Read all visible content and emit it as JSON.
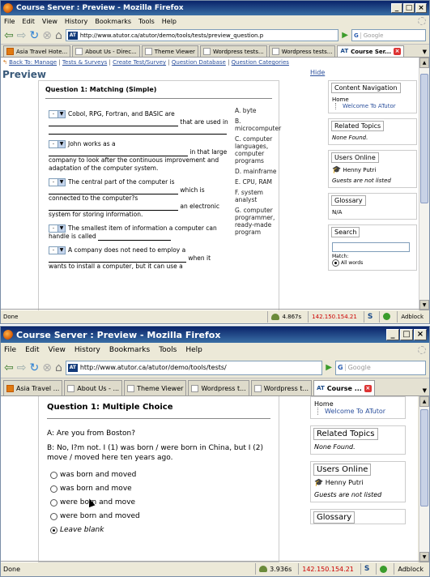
{
  "window1": {
    "title": "Course Server : Preview - Mozilla Firefox",
    "menu": [
      "File",
      "Edit",
      "View",
      "History",
      "Bookmarks",
      "Tools",
      "Help"
    ],
    "url": "http://www.atutor.ca/atutor/demo/tools/tests/preview_question.p",
    "search_placeholder": "Google",
    "tabs": [
      "Asia Travel Hote...",
      "About Us - Direc...",
      "Theme Viewer",
      "Wordpress tests...",
      "Wordpress tests...",
      "Course Ser..."
    ],
    "breadcrumbs": {
      "back": "Back To: Manage",
      "items": [
        "Tests & Surveys",
        "Create Test/Survey",
        "Question Database",
        "Question Categories"
      ]
    },
    "page_title": "Preview",
    "hide_label": "Hide",
    "question_heading": "Question 1:   Matching (Simple)",
    "dropdown_value": "-",
    "rows": [
      {
        "pre": "Cobol, RPG, Fortran, and BASIC are",
        "mid": "that are used in"
      },
      {
        "pre": "John works as a",
        "mid": "in that large",
        "post": "company to look after the continuous improvement and adaptation of the computer system."
      },
      {
        "pre": "The central part of the computer is",
        "mid": "which is",
        "post": "connected to the computer?s",
        "post2": "an electronic system for storing information."
      },
      {
        "pre": "The smallest item of information a computer can handle is called"
      },
      {
        "pre": "A company does not need to employ a",
        "mid": "when it",
        "post": "wants to install a computer, but it can use a"
      }
    ],
    "answers": [
      "A. byte",
      "B. microcomputer",
      "C. computer languages, computer programs",
      "D. mainframe",
      "E. CPU, RAM",
      "F. system analyst",
      "G. computer programmer, ready-made program"
    ],
    "sidebar": {
      "content_nav": "Content Navigation",
      "home": "Home",
      "welcome": "Welcome To ATutor",
      "related": "Related Topics",
      "none_found": "None Found.",
      "users_online": "Users Online",
      "user": "Henny Putri",
      "guests": "Guests are not listed",
      "glossary": "Glossary",
      "na": "N/A",
      "search": "Search",
      "match": "Match:",
      "all_words": "All words"
    },
    "status": {
      "done": "Done",
      "time": "4.867s",
      "ip": "142.150.154.21",
      "adblock": "Adblock"
    }
  },
  "window2": {
    "title": "Course Server : Preview - Mozilla Firefox",
    "menu": [
      "File",
      "Edit",
      "View",
      "History",
      "Bookmarks",
      "Tools",
      "Help"
    ],
    "url": "http://www.atutor.ca/atutor/demo/tools/tests/",
    "search_placeholder": "Google",
    "tabs": [
      "Asia Travel ...",
      "About Us - ...",
      "Theme Viewer",
      "Wordpress t...",
      "Wordpress t...",
      "Course ..."
    ],
    "question_heading": "Question 1:   Multiple Choice",
    "question_a": "A: Are you from Boston?",
    "question_b": "B: No, I?m not. I (1) was born / were born in China, but I (2) move / moved here ten years ago.",
    "choices": [
      "was born and moved",
      "was born and move",
      "were born and move",
      "were born and moved",
      "Leave blank"
    ],
    "sidebar": {
      "home": "Home",
      "welcome": "Welcome To ATutor",
      "related": "Related Topics",
      "none_found": "None Found.",
      "users_online": "Users Online",
      "user": "Henny Putri",
      "guests": "Guests are not listed",
      "glossary": "Glossary"
    },
    "status": {
      "done": "Done",
      "time": "3.936s",
      "ip": "142.150.154.21",
      "adblock": "Adblock"
    }
  }
}
